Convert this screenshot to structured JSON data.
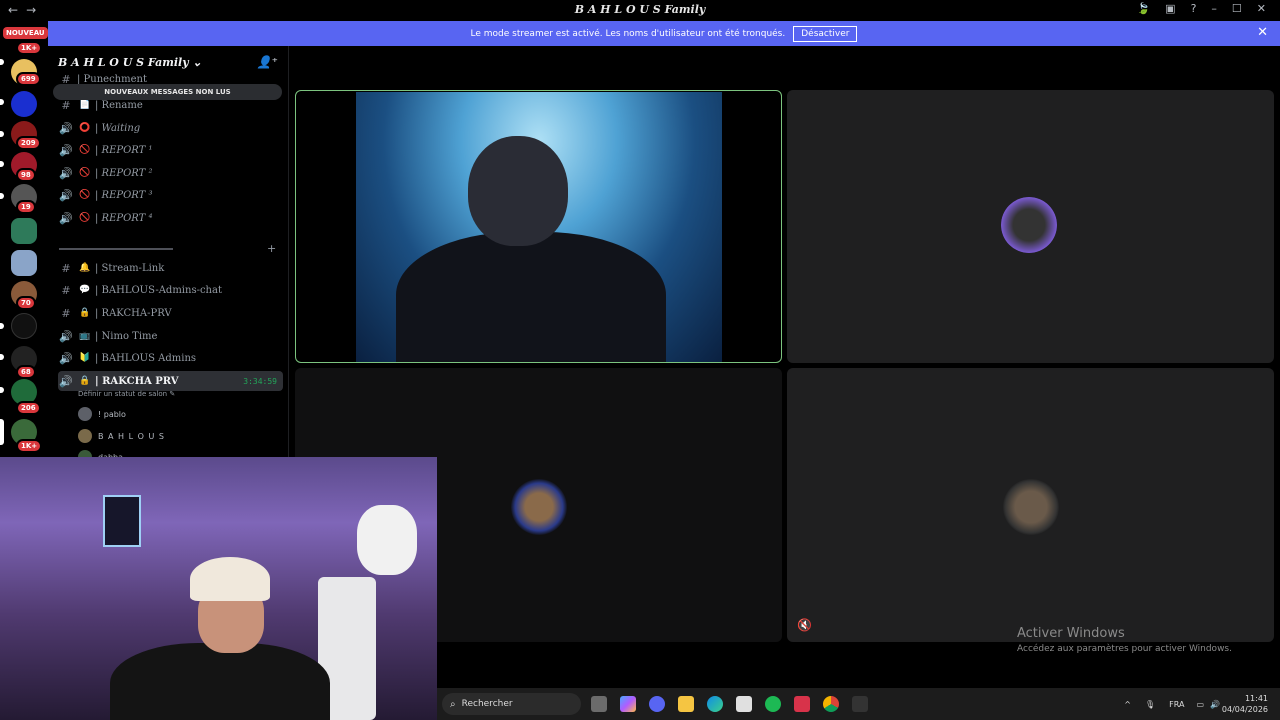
{
  "window": {
    "title": "B A H L O U S Family",
    "nav_back": "←",
    "nav_forward": "→",
    "controls": [
      "–",
      "☐",
      "✕"
    ]
  },
  "banner": {
    "message": "Le mode streamer est activé. Les noms d'utilisateur ont été tronqués.",
    "button": "Désactiver",
    "close": "✕"
  },
  "servers": {
    "new_label": "NOUVEAU",
    "badges": [
      "1K+",
      "699",
      "209",
      "98",
      "19",
      "70",
      "68",
      "206",
      "1K+"
    ]
  },
  "guild": {
    "name": "B A H L O U S Family",
    "unread_banner": "NOUVEAUX MESSAGES NON LUS",
    "partial_channel": "| Punechment",
    "channels_top": [
      {
        "icon": "#",
        "emoji": "📄",
        "name": "| Rename"
      },
      {
        "icon": "🔊",
        "emoji": "⭕",
        "name": "| Waiting"
      },
      {
        "icon": "🔊",
        "emoji": "🚫",
        "name": "| REPORT ¹"
      },
      {
        "icon": "🔊",
        "emoji": "🚫",
        "name": "| REPORT ²"
      },
      {
        "icon": "🔊",
        "emoji": "🚫",
        "name": "| REPORT ³"
      },
      {
        "icon": "🔊",
        "emoji": "🚫",
        "name": "| REPORT ⁴"
      }
    ],
    "channels_bottom": [
      {
        "icon": "#",
        "emoji": "🔔",
        "name": "| Stream-Link"
      },
      {
        "icon": "#",
        "emoji": "💬",
        "name": "| BAHLOUS-Admins-chat"
      },
      {
        "icon": "#",
        "emoji": "🔒",
        "name": "| RAKCHA-PRV"
      },
      {
        "icon": "🔊",
        "emoji": "📺",
        "name": "| Nimo Time"
      },
      {
        "icon": "🔊",
        "emoji": "🔰",
        "name": "| BAHLOUS Admins"
      }
    ],
    "active_channel": {
      "icon": "🔊",
      "emoji": "🔒",
      "name": "| RAKCHA PRV",
      "timer": "3:34:59",
      "status": "Définir un statut de salon ✎"
    },
    "members": [
      "! pablo",
      "B A H L O U S",
      "dabba"
    ]
  },
  "stage": {
    "muted_icon": "🔇",
    "watermark_title": "Activer Windows",
    "watermark_sub": "Accédez aux paramètres pour activer Windows."
  },
  "taskbar": {
    "search_placeholder": "Rechercher",
    "language": "FRA",
    "time": "11:41",
    "date": "04/04/2026",
    "chevron": "^"
  }
}
